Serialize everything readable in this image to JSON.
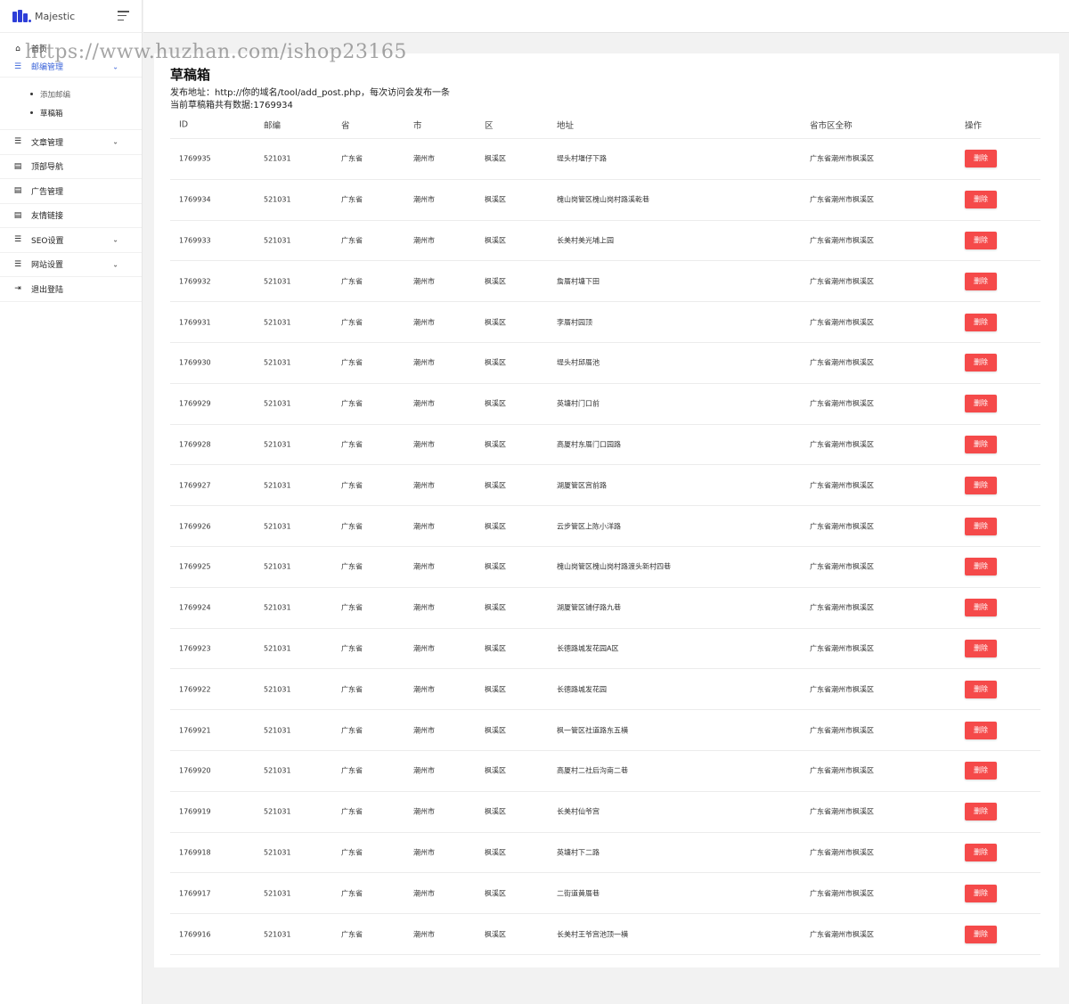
{
  "brand": {
    "name": "Majestic",
    "accent": "#2d3ed8"
  },
  "watermark": "https://www.huzhan.com/ishop23165",
  "sidebar": {
    "home": "首页",
    "mail_mgmt": "邮编管理",
    "mail_sub": [
      "添加邮编",
      "草稿箱"
    ],
    "items": [
      {
        "label": "文章管理",
        "icon": "list-icon",
        "chevron": "⌄"
      },
      {
        "label": "顶部导航",
        "icon": "layout-icon",
        "chevron": ""
      },
      {
        "label": "广告管理",
        "icon": "layout-icon",
        "chevron": ""
      },
      {
        "label": "友情链接",
        "icon": "layout-icon",
        "chevron": ""
      },
      {
        "label": "SEO设置",
        "icon": "list-icon",
        "chevron": "⌄"
      },
      {
        "label": "网站设置",
        "icon": "list-icon",
        "chevron": "⌄"
      },
      {
        "label": "退出登陆",
        "icon": "logout-icon",
        "chevron": ""
      }
    ]
  },
  "page": {
    "title": "草稿箱",
    "publish_info": "发布地址：http://你的域名/tool/add_post.php，每次访问会发布一条",
    "count_info": "当前草稿箱共有数据:1769934"
  },
  "table": {
    "headers": {
      "id": "ID",
      "zip": "邮编",
      "prov": "省",
      "city": "市",
      "dist": "区",
      "addr": "地址",
      "full": "省市区全称",
      "op": "操作"
    },
    "delete_label": "删除",
    "delete_color": "#f54a4a",
    "rows": [
      {
        "id": "1769935",
        "zip": "521031",
        "prov": "广东省",
        "city": "潮州市",
        "dist": "枫溪区",
        "addr": "堤头村堰仔下路",
        "full": "广东省潮州市枫溪区"
      },
      {
        "id": "1769934",
        "zip": "521031",
        "prov": "广东省",
        "city": "潮州市",
        "dist": "枫溪区",
        "addr": "槐山岗管区槐山岗村路溪乾巷",
        "full": "广东省潮州市枫溪区"
      },
      {
        "id": "1769933",
        "zip": "521031",
        "prov": "广东省",
        "city": "潮州市",
        "dist": "枫溪区",
        "addr": "长美村美光埔上园",
        "full": "广东省潮州市枫溪区"
      },
      {
        "id": "1769932",
        "zip": "521031",
        "prov": "广东省",
        "city": "潮州市",
        "dist": "枫溪区",
        "addr": "詹厝村塘下田",
        "full": "广东省潮州市枫溪区"
      },
      {
        "id": "1769931",
        "zip": "521031",
        "prov": "广东省",
        "city": "潮州市",
        "dist": "枫溪区",
        "addr": "李厝村园顶",
        "full": "广东省潮州市枫溪区"
      },
      {
        "id": "1769930",
        "zip": "521031",
        "prov": "广东省",
        "city": "潮州市",
        "dist": "枫溪区",
        "addr": "堤头村邱厝池",
        "full": "广东省潮州市枫溪区"
      },
      {
        "id": "1769929",
        "zip": "521031",
        "prov": "广东省",
        "city": "潮州市",
        "dist": "枫溪区",
        "addr": "英塘村门口前",
        "full": "广东省潮州市枫溪区"
      },
      {
        "id": "1769928",
        "zip": "521031",
        "prov": "广东省",
        "city": "潮州市",
        "dist": "枫溪区",
        "addr": "高厦村东厝门口园路",
        "full": "广东省潮州市枫溪区"
      },
      {
        "id": "1769927",
        "zip": "521031",
        "prov": "广东省",
        "city": "潮州市",
        "dist": "枫溪区",
        "addr": "湖厦管区宫前路",
        "full": "广东省潮州市枫溪区"
      },
      {
        "id": "1769926",
        "zip": "521031",
        "prov": "广东省",
        "city": "潮州市",
        "dist": "枫溪区",
        "addr": "云步管区上陈小洋路",
        "full": "广东省潮州市枫溪区"
      },
      {
        "id": "1769925",
        "zip": "521031",
        "prov": "广东省",
        "city": "潮州市",
        "dist": "枫溪区",
        "addr": "槐山岗管区槐山岗村路渡头新村四巷",
        "full": "广东省潮州市枫溪区"
      },
      {
        "id": "1769924",
        "zip": "521031",
        "prov": "广东省",
        "city": "潮州市",
        "dist": "枫溪区",
        "addr": "湖厦管区铺仔路九巷",
        "full": "广东省潮州市枫溪区"
      },
      {
        "id": "1769923",
        "zip": "521031",
        "prov": "广东省",
        "city": "潮州市",
        "dist": "枫溪区",
        "addr": "长德路城发花园A区",
        "full": "广东省潮州市枫溪区"
      },
      {
        "id": "1769922",
        "zip": "521031",
        "prov": "广东省",
        "city": "潮州市",
        "dist": "枫溪区",
        "addr": "长德路城发花园",
        "full": "广东省潮州市枫溪区"
      },
      {
        "id": "1769921",
        "zip": "521031",
        "prov": "广东省",
        "city": "潮州市",
        "dist": "枫溪区",
        "addr": "枫一管区社道路东五横",
        "full": "广东省潮州市枫溪区"
      },
      {
        "id": "1769920",
        "zip": "521031",
        "prov": "广东省",
        "city": "潮州市",
        "dist": "枫溪区",
        "addr": "高厦村二社后沟南二巷",
        "full": "广东省潮州市枫溪区"
      },
      {
        "id": "1769919",
        "zip": "521031",
        "prov": "广东省",
        "city": "潮州市",
        "dist": "枫溪区",
        "addr": "长美村仙爷宫",
        "full": "广东省潮州市枫溪区"
      },
      {
        "id": "1769918",
        "zip": "521031",
        "prov": "广东省",
        "city": "潮州市",
        "dist": "枫溪区",
        "addr": "英塘村下二路",
        "full": "广东省潮州市枫溪区"
      },
      {
        "id": "1769917",
        "zip": "521031",
        "prov": "广东省",
        "city": "潮州市",
        "dist": "枫溪区",
        "addr": "二街道黄厝巷",
        "full": "广东省潮州市枫溪区"
      },
      {
        "id": "1769916",
        "zip": "521031",
        "prov": "广东省",
        "city": "潮州市",
        "dist": "枫溪区",
        "addr": "长美村王爷宫池顶一横",
        "full": "广东省潮州市枫溪区"
      }
    ]
  }
}
